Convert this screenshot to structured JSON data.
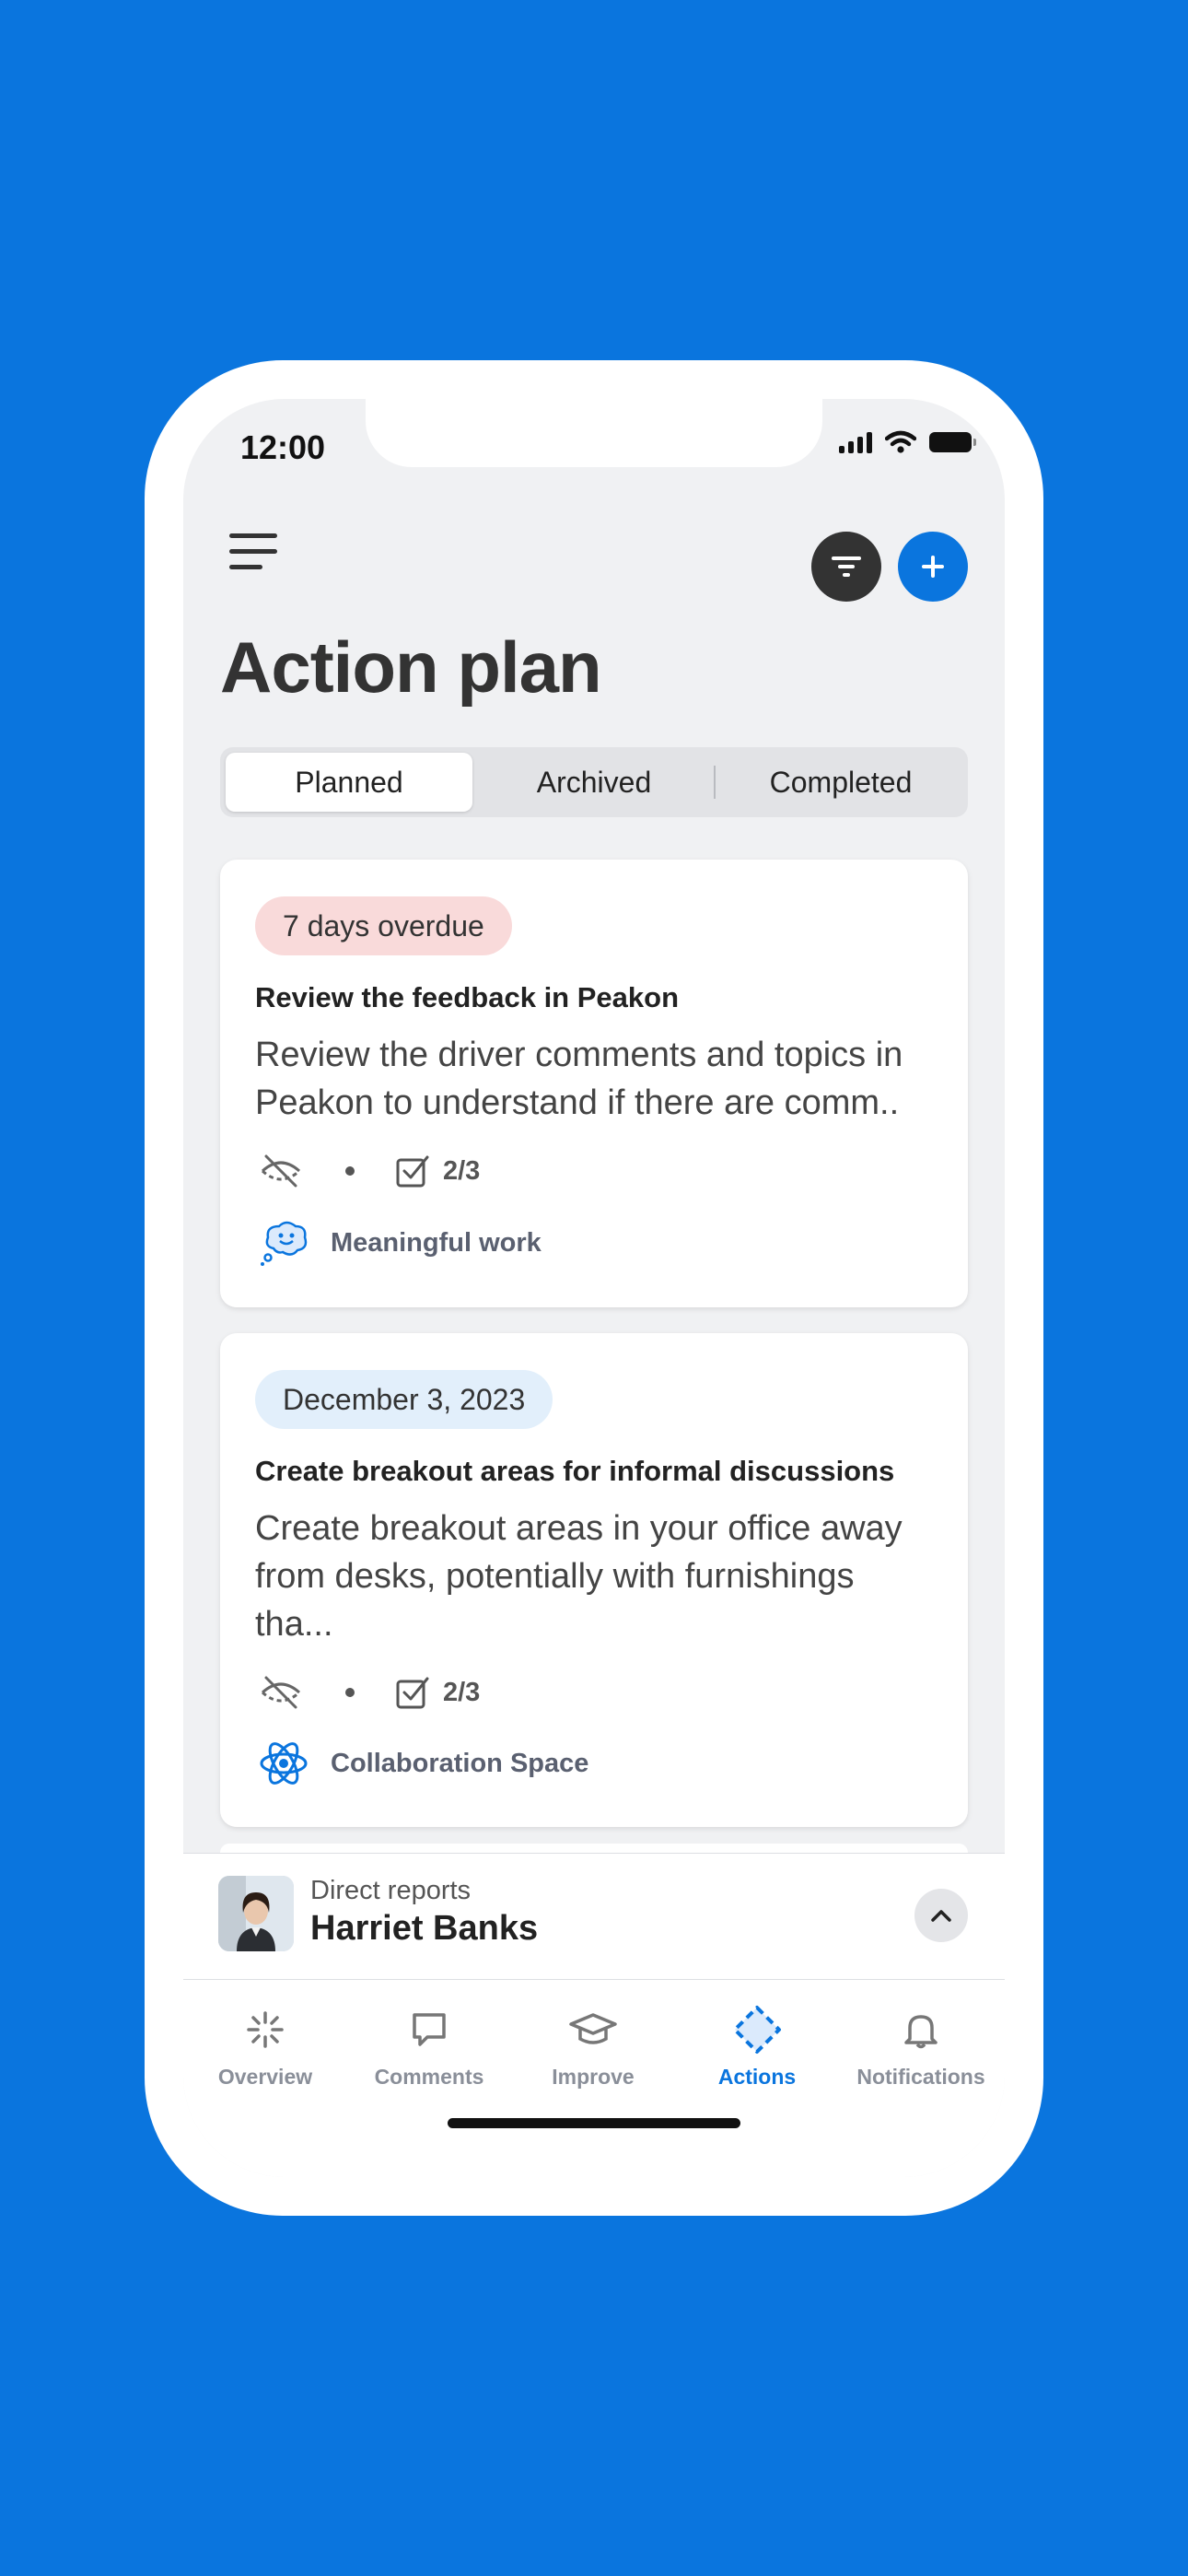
{
  "status_bar": {
    "time": "12:00"
  },
  "header": {
    "title": "Action plan"
  },
  "tabs": [
    {
      "label": "Planned",
      "active": true
    },
    {
      "label": "Archived",
      "active": false
    },
    {
      "label": "Completed",
      "active": false
    }
  ],
  "actions": [
    {
      "badge": "7 days overdue",
      "badge_type": "overdue",
      "title": "Review the feedback in Peakon",
      "description": "Review the driver comments and topics in Peakon to understand if there are comm..",
      "visibility_icon": "eye-off-icon",
      "tasks": "2/3",
      "driver": "Meaningful work",
      "driver_icon": "thought-bubble-icon"
    },
    {
      "badge": "December  3, 2023",
      "badge_type": "date",
      "title": "Create breakout areas for informal discussions",
      "description": "Create breakout areas in your office away from desks, potentially with furnishings tha...",
      "visibility_icon": "eye-off-icon",
      "tasks": "2/3",
      "driver": "Collaboration Space",
      "driver_icon": "atom-icon"
    }
  ],
  "direct_reports": {
    "caption": "Direct reports",
    "name": "Harriet Banks"
  },
  "nav": [
    {
      "label": "Overview",
      "icon": "sparkle-icon",
      "active": false
    },
    {
      "label": "Comments",
      "icon": "chat-bubble-icon",
      "active": false
    },
    {
      "label": "Improve",
      "icon": "graduation-cap-icon",
      "active": false
    },
    {
      "label": "Actions",
      "icon": "diamond-dashed-icon",
      "active": true
    },
    {
      "label": "Notifications",
      "icon": "bell-icon",
      "active": false
    }
  ],
  "colors": {
    "background": "#0a75de",
    "accent": "#0a75de",
    "overdue_pill": "#f9dada",
    "date_pill": "#e2effb"
  }
}
